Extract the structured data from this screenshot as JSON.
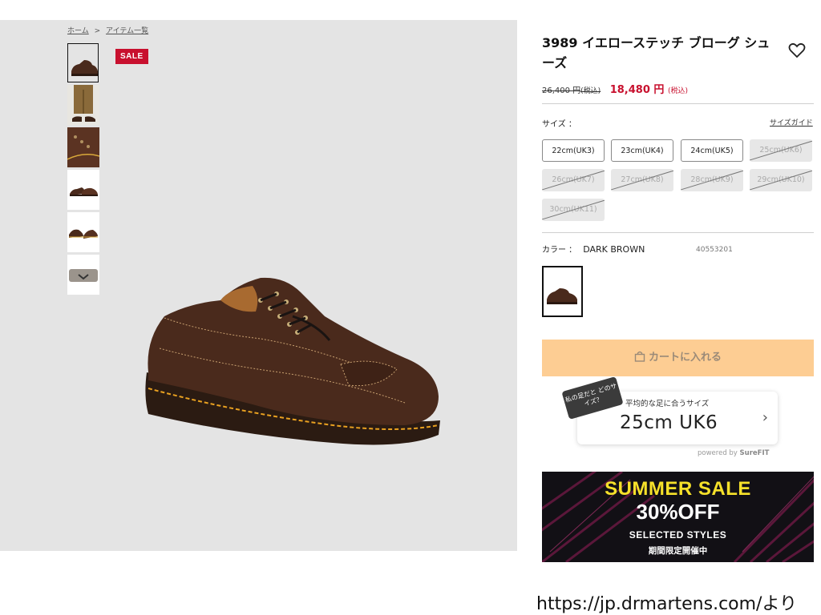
{
  "breadcrumb": {
    "home": "ホーム",
    "sep": ">",
    "current": "アイテム一覧"
  },
  "sale_badge": "SALE",
  "product": {
    "name": "3989 イエローステッチ ブローグ シューズ",
    "old_price": "26,400 円",
    "old_tax": "(税込)",
    "new_price": "18,480 円",
    "new_tax": "(税込)"
  },
  "size": {
    "label": "サイズ ：",
    "guide": "サイズガイド",
    "options": [
      {
        "label": "22cm(UK3)",
        "available": true
      },
      {
        "label": "23cm(UK4)",
        "available": true
      },
      {
        "label": "24cm(UK5)",
        "available": true
      },
      {
        "label": "25cm(UK6)",
        "available": false
      },
      {
        "label": "26cm(UK7)",
        "available": false
      },
      {
        "label": "27cm(UK8)",
        "available": false
      },
      {
        "label": "28cm(UK9)",
        "available": false
      },
      {
        "label": "29cm(UK10)",
        "available": false
      },
      {
        "label": "30cm(UK11)",
        "available": false
      }
    ]
  },
  "color": {
    "label": "カラー ：",
    "name": "DARK BROWN",
    "code": "40553201"
  },
  "cart_button": "カートに入れる",
  "surefit": {
    "tag": "私の足だと どのサイズ？",
    "subtitle": "平均的な足に合うサイズ",
    "size": "25cm UK6",
    "powered_prefix": "powered by ",
    "powered_brand": "SureFIT"
  },
  "banner": {
    "line1": "SUMMER SALE",
    "line2": "30%OFF",
    "line3": "SELECTED STYLES",
    "line4": "期間限定開催中"
  },
  "source_note": "https://jp.drmartens.com/より",
  "colors": {
    "sale_red": "#c8102e",
    "cart_bg": "#fdcd93",
    "gallery_bg": "#e4e4e4",
    "banner_yellow": "#f6e12a"
  },
  "icons": [
    "heart-icon",
    "cart-bag-icon",
    "chevron-right-icon"
  ]
}
